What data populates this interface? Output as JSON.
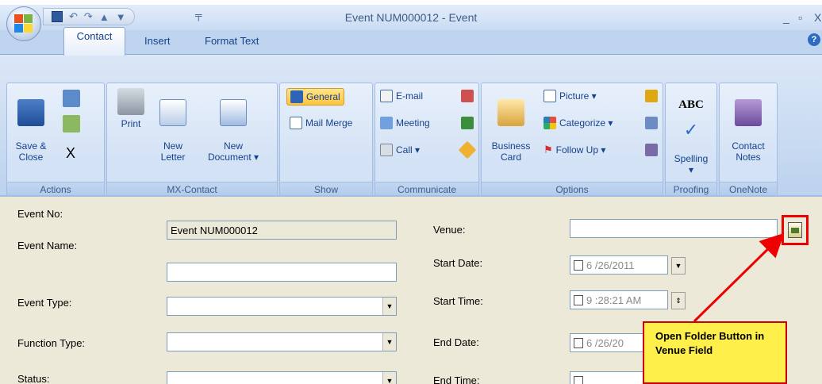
{
  "window": {
    "title": "Event NUM000012 - Event",
    "controls": {
      "minimize": "_",
      "restore": "▫",
      "close": "X"
    }
  },
  "qat": {
    "undo": "↶",
    "redo": "↷",
    "up": "▲",
    "down": "▼",
    "more": "╤"
  },
  "tabs": [
    {
      "label": "Contact",
      "active": true
    },
    {
      "label": "Insert",
      "active": false
    },
    {
      "label": "Format Text",
      "active": false
    }
  ],
  "help_label": "?",
  "ribbon": {
    "actions": {
      "label": "Actions",
      "save_close": "Save &\nClose",
      "delete": "X"
    },
    "mxcontact": {
      "label": "MX-Contact",
      "print": "Print",
      "new_letter": "New\nLetter",
      "new_document": "New\nDocument ▾"
    },
    "show": {
      "label": "Show",
      "general": "General",
      "mail_merge": "Mail Merge"
    },
    "communicate": {
      "label": "Communicate",
      "email": "E-mail",
      "meeting": "Meeting",
      "call": "Call ▾"
    },
    "options": {
      "label": "Options",
      "business_card": "Business\nCard",
      "picture": "Picture ▾",
      "categorize": "Categorize ▾",
      "follow_up": "Follow Up ▾"
    },
    "proofing": {
      "label": "Proofing",
      "spelling": "Spelling\n▾",
      "abc": "ABC"
    },
    "onenote": {
      "label": "OneNote",
      "contact_notes": "Contact\nNotes"
    }
  },
  "form": {
    "event_no": {
      "label": "Event No:",
      "value": "Event NUM000012"
    },
    "event_name": {
      "label": "Event Name:",
      "value": ""
    },
    "event_type": {
      "label": "Event Type:",
      "value": ""
    },
    "function_type": {
      "label": "Function Type:",
      "value": ""
    },
    "status": {
      "label": "Status:",
      "value": ""
    },
    "venue": {
      "label": "Venue:",
      "value": ""
    },
    "start_date": {
      "label": "Start Date:",
      "value": "6 /26/2011"
    },
    "start_time": {
      "label": "Start Time:",
      "value": "9 :28:21 AM"
    },
    "end_date": {
      "label": "End Date:",
      "value": "6 /26/20"
    },
    "end_time": {
      "label": "End Time:",
      "value": ""
    }
  },
  "callout": {
    "text": "Open Folder Button in Venue Field"
  },
  "colors": {
    "highlight": "#ff0000",
    "callout_bg": "#ffef4a",
    "ribbon": "#c9dbf2",
    "form_bg": "#ece9d8"
  }
}
